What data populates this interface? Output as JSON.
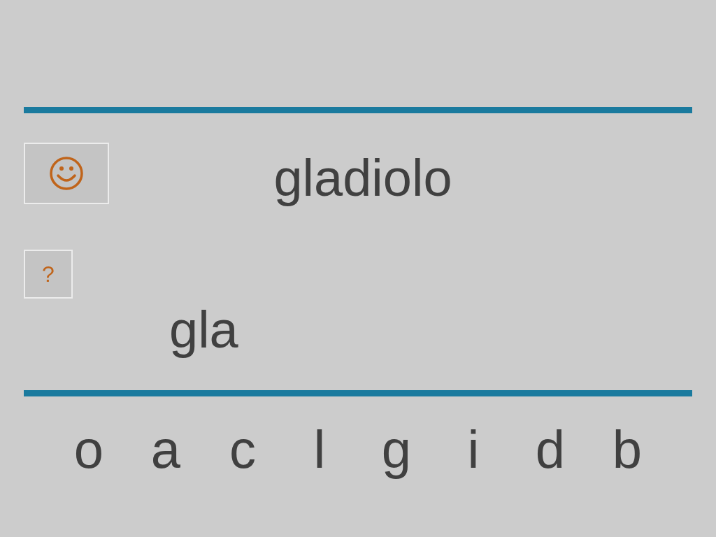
{
  "prompt_word": "gladiolo",
  "help_button": {
    "label": "?"
  },
  "answer": "gla",
  "letters": [
    {
      "label": "o"
    },
    {
      "label": "a"
    },
    {
      "label": "c"
    },
    {
      "label": "l"
    },
    {
      "label": "g"
    },
    {
      "label": "i"
    },
    {
      "label": "d"
    },
    {
      "label": "b"
    }
  ]
}
